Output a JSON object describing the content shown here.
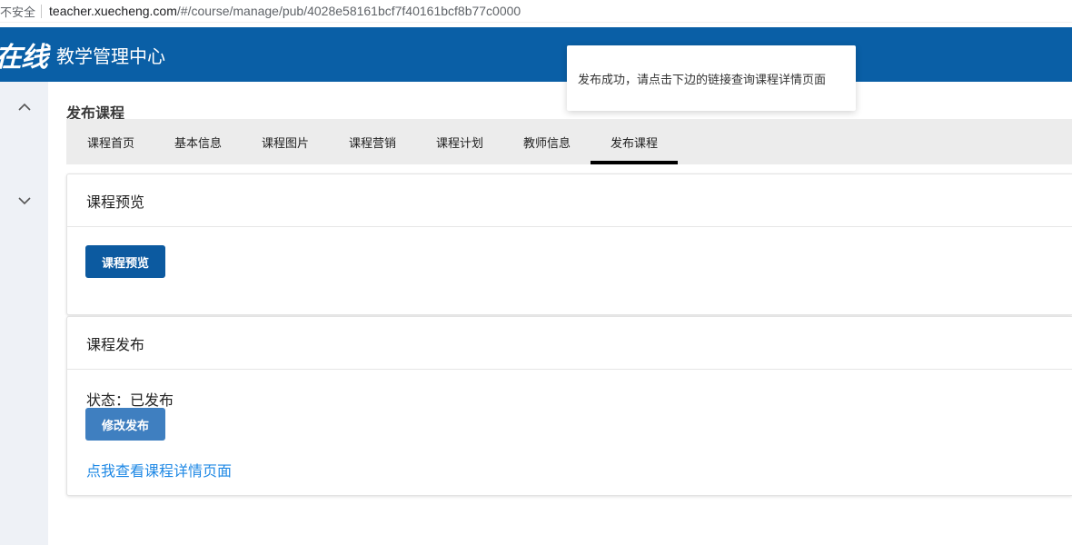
{
  "browser": {
    "insecure_label": "不安全",
    "url_host": "teacher.xuecheng.com",
    "url_path": "/#/course/manage/pub/4028e58161bcf7f40161bcf8b77c0000"
  },
  "header": {
    "logo_text": "在线",
    "title": "教学管理中心"
  },
  "sidebar": {
    "items": [
      {
        "icon": "chevron-up-icon"
      },
      {
        "icon": "chevron-down-icon"
      }
    ]
  },
  "page": {
    "title": "发布课程"
  },
  "tabs": [
    {
      "label": "课程首页",
      "active": false
    },
    {
      "label": "基本信息",
      "active": false
    },
    {
      "label": "课程图片",
      "active": false
    },
    {
      "label": "课程营销",
      "active": false
    },
    {
      "label": "课程计划",
      "active": false
    },
    {
      "label": "教师信息",
      "active": false
    },
    {
      "label": "发布课程",
      "active": true
    }
  ],
  "preview_card": {
    "title": "课程预览",
    "button_label": "课程预览"
  },
  "publish_card": {
    "title": "课程发布",
    "status_text": "状态：已发布",
    "modify_button_label": "修改发布",
    "detail_link_text": "点我查看课程详情页面"
  },
  "toast": {
    "message": "发布成功，请点击下边的链接查询课程详情页面"
  },
  "colors": {
    "header_bg": "#0a5fa6",
    "primary_button": "#0c5aa0",
    "secondary_button": "#3f7fc0",
    "link": "#1e88e5"
  }
}
